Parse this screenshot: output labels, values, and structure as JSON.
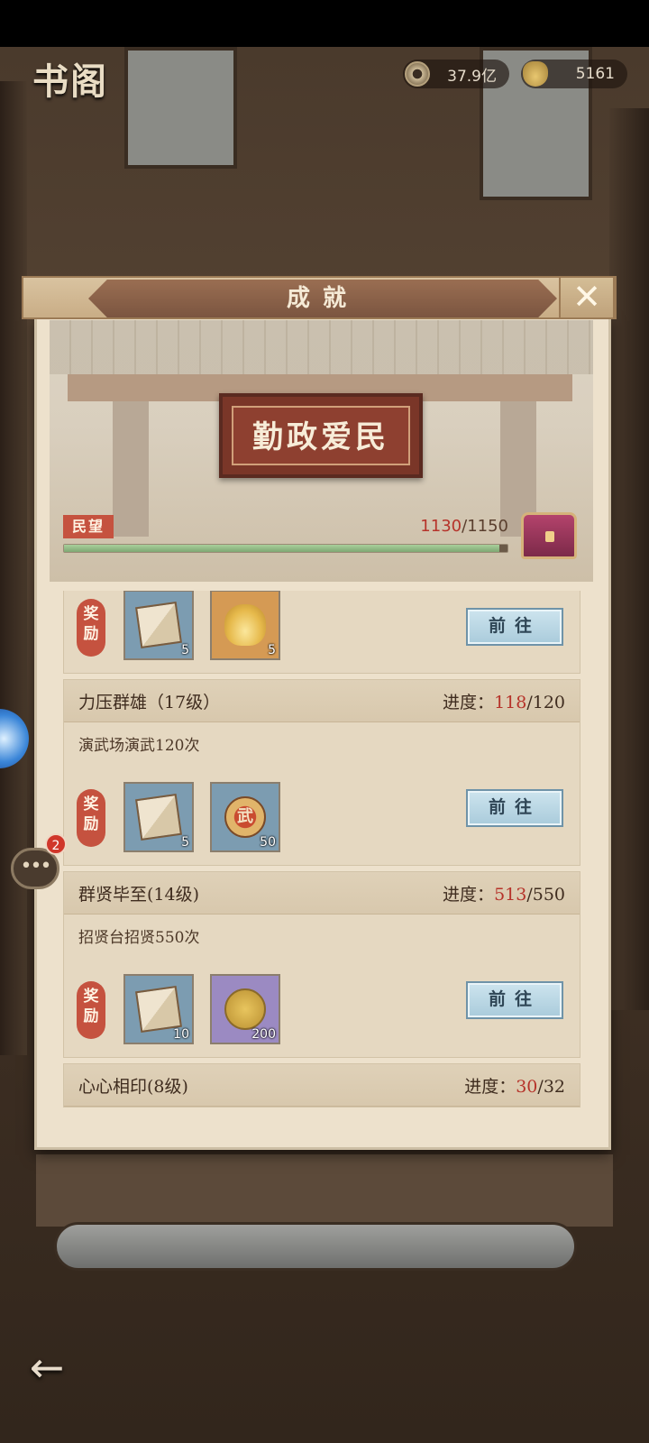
{
  "top": {
    "title": "书阁",
    "resources": [
      {
        "icon": "copper-coin-icon",
        "value": "37.9亿"
      },
      {
        "icon": "gold-ingot-icon",
        "value": "5161"
      }
    ]
  },
  "panel": {
    "title": "成就",
    "close_icon": "✕",
    "plaque_text": "勤政爱民",
    "reputation": {
      "label": "民望",
      "current": "1130",
      "sep": "/",
      "max": "1150",
      "fraction": 0.9826
    }
  },
  "achievements": [
    {
      "name": "",
      "progress_label": "",
      "current": "",
      "sep": "",
      "goal": "",
      "description": "",
      "reward_label": "奖励",
      "rewards": [
        {
          "icon": "book-icon",
          "qty": "5",
          "color": "blue"
        },
        {
          "icon": "gold-ingot-icon",
          "qty": "5",
          "color": "orange"
        }
      ],
      "button": "前往"
    },
    {
      "name": "力压群雄（17级）",
      "progress_label": "进度：",
      "current": "118",
      "sep": "/",
      "goal": "120",
      "description": "演武场演武120次",
      "reward_label": "奖励",
      "rewards": [
        {
          "icon": "book-icon",
          "qty": "5",
          "color": "blue"
        },
        {
          "icon": "martial-medal-icon",
          "glyph": "武",
          "qty": "50",
          "color": "blue"
        }
      ],
      "button": "前往"
    },
    {
      "name": "群贤毕至(14级)",
      "progress_label": "进度：",
      "current": "513",
      "sep": "/",
      "goal": "550",
      "description": "招贤台招贤550次",
      "reward_label": "奖励",
      "rewards": [
        {
          "icon": "book-icon",
          "qty": "10",
          "color": "blue"
        },
        {
          "icon": "gold-coin-icon",
          "qty": "200",
          "color": "purple"
        }
      ],
      "button": "前往"
    },
    {
      "name": "心心相印(8级)",
      "progress_label": "进度：",
      "current": "30",
      "sep": "/",
      "goal": "32"
    }
  ],
  "chat": {
    "badge": "2",
    "icon": "chat-bubble-icon"
  },
  "nav": {
    "back_icon": "back-arrow-icon"
  }
}
